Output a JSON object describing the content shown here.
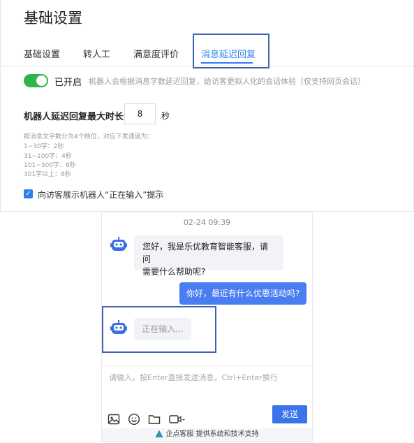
{
  "settings": {
    "title": "基础设置",
    "tabs": [
      {
        "label": "基础设置",
        "active": false
      },
      {
        "label": "转人工",
        "active": false
      },
      {
        "label": "满意度评价",
        "active": false
      },
      {
        "label": "消息延迟回复",
        "active": true
      }
    ],
    "toggle": {
      "on": true,
      "label": "已开启",
      "description": "机器人会根据消息字数延迟回复，给访客更拟人化的会话体验（仅支持网页会话）"
    },
    "delay": {
      "label": "机器人延迟回复最大时长",
      "value": "8",
      "unit": "秒"
    },
    "hints": [
      "按消息文字数分为4个档位，对应下发速度为：",
      "1~30字：2秒",
      "31~100字：4秒",
      "101~300字：6秒",
      "301字以上：8秒"
    ],
    "typing_option": {
      "checked": true,
      "label": "向访客展示机器人“正在输入”提示",
      "help_icon": "question-circle-icon"
    }
  },
  "chat": {
    "timestamp": "02-24 09:39",
    "bot_greeting_line1": "您好，我是乐优教育智能客服，请问",
    "bot_greeting_line2": "需要什么帮助呢?",
    "user_message": "你好，最近有什么优惠活动吗?",
    "typing_text": "正在输入...",
    "input_placeholder": "请输入，按Enter直接发送消息，Ctrl+Enter换行",
    "send_label": "发送",
    "footer_brand": "企点客服",
    "footer_text": "提供系统和技术支持",
    "tools": [
      "image-icon",
      "emoji-icon",
      "folder-icon",
      "video-icon"
    ]
  },
  "colors": {
    "accent": "#2d7ff0",
    "toggle_on": "#2db54c",
    "highlight": "#3f63b7",
    "user_bubble": "#4a7cf2"
  }
}
